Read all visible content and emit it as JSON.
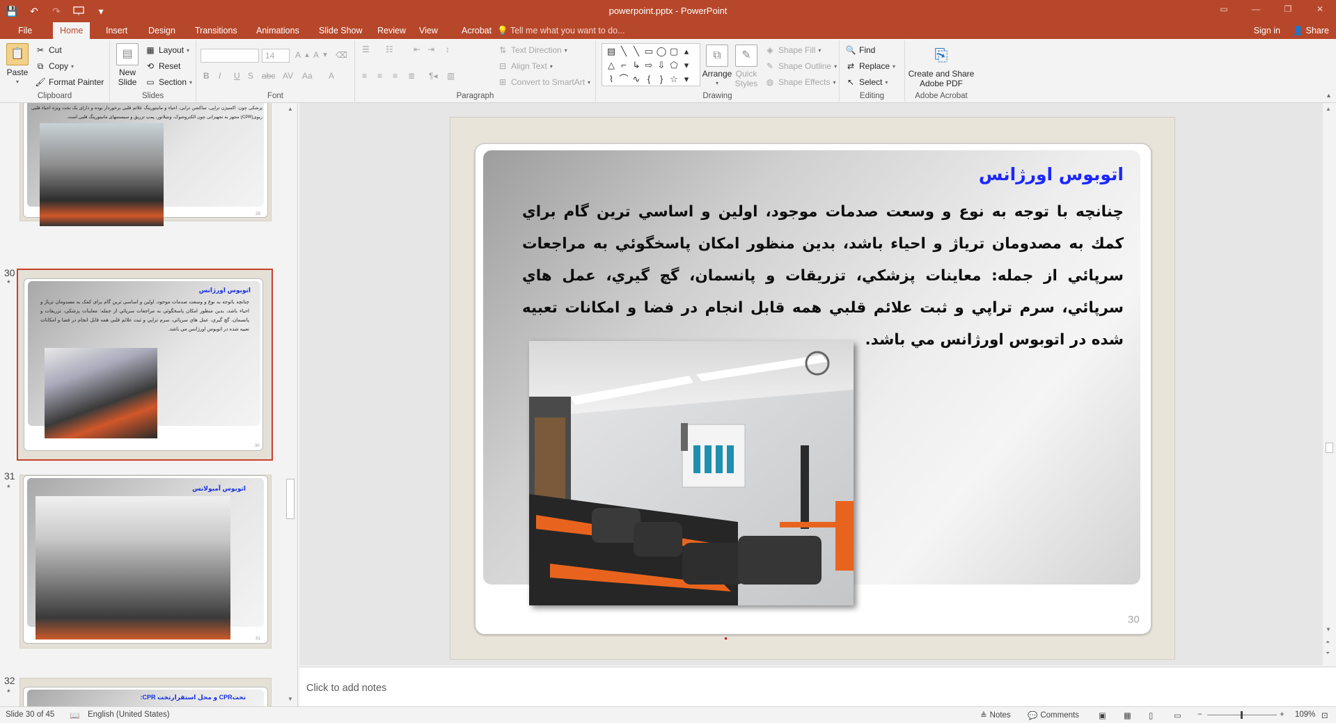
{
  "app": {
    "window_title": "powerpoint.pptx - PowerPoint",
    "window_controls": [
      "▭",
      "—",
      "❐",
      "✕"
    ]
  },
  "quick_access": {
    "save": "💾",
    "undo": "↶",
    "redo": "↷",
    "customize": "▾"
  },
  "tabs": [
    {
      "label": "File"
    },
    {
      "label": "Home",
      "active": true
    },
    {
      "label": "Insert"
    },
    {
      "label": "Design"
    },
    {
      "label": "Transitions"
    },
    {
      "label": "Animations"
    },
    {
      "label": "Slide Show"
    },
    {
      "label": "Review"
    },
    {
      "label": "View"
    },
    {
      "label": "Acrobat"
    }
  ],
  "tell_me": "Tell me what you want to do...",
  "account": {
    "signin": "Sign in",
    "share": "Share"
  },
  "ribbon": {
    "clipboard": {
      "label": "Clipboard",
      "paste": "Paste",
      "cut": "Cut",
      "copy": "Copy",
      "format_painter": "Format Painter"
    },
    "slides": {
      "label": "Slides",
      "new_slide_1": "New",
      "new_slide_2": "Slide",
      "layout": "Layout",
      "reset": "Reset",
      "section": "Section"
    },
    "font": {
      "label": "Font",
      "font_name": "",
      "font_size": "14"
    },
    "paragraph": {
      "label": "Paragraph",
      "text_direction": "Text Direction",
      "align_text": "Align Text",
      "smartart": "Convert to SmartArt"
    },
    "drawing": {
      "label": "Drawing",
      "arrange": "Arrange",
      "quick_styles_1": "Quick",
      "quick_styles_2": "Styles",
      "shape_fill": "Shape Fill",
      "shape_outline": "Shape Outline",
      "shape_effects": "Shape Effects"
    },
    "editing": {
      "label": "Editing",
      "find": "Find",
      "replace": "Replace",
      "select": "Select"
    },
    "acrobat": {
      "label": "Adobe Acrobat",
      "create_1": "Create and Share",
      "create_2": "Adobe PDF"
    }
  },
  "thumbnails": {
    "slide_29": {
      "text": "پزشکی چون: اکسیژن تراپی، ساکشن ترابی، احیاء و مانیتورینگ علائم قلبی برخوردار بوده و دارای یک تخت ویژه احیاء قلبی ریوی(CPR) مجهز به تجهیزاتی چون الکتروشوک، ونتیلاتور، پمپ تزریق و سیستمهای مانیتورینگ قلبی است.",
      "num": "29"
    },
    "slide_30": {
      "number": "30",
      "star": "*",
      "title": "اتوبوس اورژانس",
      "text": "چنانچه باتوجه به نوع و وسعت صدمات موجود، اولین و اساسی ترین گام برای کمک به مصدومان ترياژ و احياء باشد، بدين منظور امکان پاسخگوئي به مراجعات سرپائي از جمله: معاينات پزشکي، تزريقات و پانسمان، گچ گيري، عمل هاي سرپائي، سرم تراپي و ثبت علائم قلبي همه قابل انجام در فضا و امکانات تعبيه شده در اتوبوس اورژانس مي باشد.",
      "num": "30"
    },
    "slide_31": {
      "number": "31",
      "star": "*",
      "title": "اتوبوس آمبولانس",
      "num": "31"
    },
    "slide_32": {
      "number": "32",
      "star": "*",
      "title": "تختCPR و محل استقرارتخت CPR:"
    }
  },
  "slide": {
    "title": "اتوبوس  اورژانس",
    "body": "چنانچه  با توجه به نوع و وسعت صدمات موجود، اولين و اساسي ترين گام براي كمك به مصدومان ترياژ و احياء باشد، بدين منظور امكان  پاسخگوئي به مراجعات سرپائي از جمله: معاينات پزشكي، تزريقات و پانسمان، گچ گيري، عمل هاي سرپائي،  سرم تراپي و ثبت علائم قلبي همه قابل انجام در فضا و امكانات تعبيه شده در اتوبوس اورژانس مي باشد.",
    "page_number": "30"
  },
  "notes": {
    "placeholder": "Click to add notes"
  },
  "status": {
    "slide_info": "Slide 30 of 45",
    "language": "English (United States)",
    "notes": "Notes",
    "comments": "Comments",
    "zoom": "109%"
  },
  "colors": {
    "accent": "#b7472a",
    "title_blue": "#1a27ff",
    "selection": "#c8412a"
  }
}
